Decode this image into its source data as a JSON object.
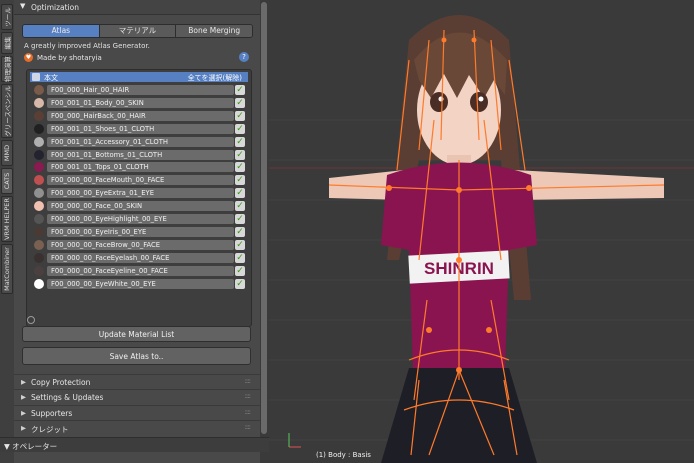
{
  "side_tabs": [
    "ツール",
    "編集",
    "物理演算",
    "グリースペンシル",
    "MMD",
    "CATS",
    "VRM HELPER",
    "MatCombiner"
  ],
  "panel": {
    "title": "Optimization",
    "tabs": [
      {
        "label": "Atlas",
        "active": true
      },
      {
        "label": "マテリアル",
        "active": false
      },
      {
        "label": "Bone Merging",
        "active": false
      }
    ],
    "description": "A greatly improved Atlas Generator.",
    "made_by": "Made by shotaryia",
    "help_icon": "?",
    "list": {
      "header_name": "本文",
      "select_all": "全てを選択(解除)",
      "materials": [
        {
          "name": "F00_000_Hair_00_HAIR",
          "color": "#7a5a48",
          "checked": true
        },
        {
          "name": "F00_001_01_Body_00_SKIN",
          "color": "#d8b8a8",
          "checked": true
        },
        {
          "name": "F00_000_HairBack_00_HAIR",
          "color": "#5a4034",
          "checked": true
        },
        {
          "name": "F00_001_01_Shoes_01_CLOTH",
          "color": "#202020",
          "checked": true
        },
        {
          "name": "F00_001_01_Accessory_01_CLOTH",
          "color": "#b0b0b0",
          "checked": true
        },
        {
          "name": "F00_001_01_Bottoms_01_CLOTH",
          "color": "#232330",
          "checked": true
        },
        {
          "name": "F00_001_01_Tops_01_CLOTH",
          "color": "#8a1a50",
          "checked": true
        },
        {
          "name": "F00_000_00_FaceMouth_00_FACE",
          "color": "#c05050",
          "checked": true
        },
        {
          "name": "F00_000_00_EyeExtra_01_EYE",
          "color": "#909090",
          "checked": true
        },
        {
          "name": "F00_000_00_Face_00_SKIN",
          "color": "#f0c0b0",
          "checked": true
        },
        {
          "name": "F00_000_00_EyeHighlight_00_EYE",
          "color": "#555555",
          "checked": true
        },
        {
          "name": "F00_000_00_EyeIris_00_EYE",
          "color": "#4a3a34",
          "checked": true
        },
        {
          "name": "F00_000_00_FaceBrow_00_FACE",
          "color": "#7a6050",
          "checked": true
        },
        {
          "name": "F00_000_00_FaceEyelash_00_FACE",
          "color": "#3a3030",
          "checked": true
        },
        {
          "name": "F00_000_00_FaceEyeline_00_FACE",
          "color": "#4a4040",
          "checked": true
        },
        {
          "name": "F00_000_00_EyeWhite_00_EYE",
          "color": "#ffffff",
          "checked": true
        }
      ]
    },
    "update_button": "Update Material List",
    "save_button": "Save Atlas to..",
    "sections": [
      "Copy Protection",
      "Settings & Updates",
      "Supporters",
      "クレジット"
    ]
  },
  "operator_panel": "オペレーター",
  "viewport": {
    "status": "(1) Body : Basis",
    "shirt_text": "SHINRIN"
  }
}
